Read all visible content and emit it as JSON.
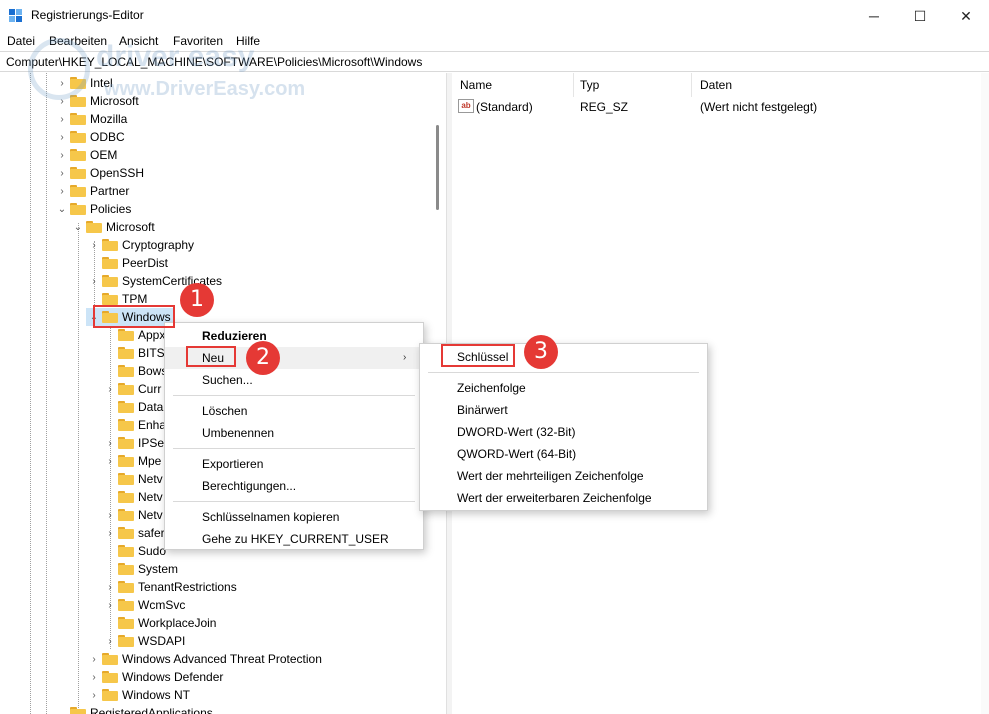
{
  "window": {
    "title": "Registrierungs-Editor",
    "minimize_glyph": "─",
    "maximize_glyph": "☐",
    "close_glyph": "✕"
  },
  "menu": [
    "Datei",
    "Bearbeiten",
    "Ansicht",
    "Favoriten",
    "Hilfe"
  ],
  "address": "Computer\\HKEY_LOCAL_MACHINE\\SOFTWARE\\Policies\\Microsoft\\Windows",
  "watermark": {
    "line1": "driver easy",
    "line2": "www.DriverEasy.com"
  },
  "tree": {
    "top_items": [
      "Intel",
      "Microsoft",
      "Mozilla",
      "ODBC",
      "OEM",
      "OpenSSH",
      "Partner"
    ],
    "policies": "Policies",
    "policies_microsoft": "Microsoft",
    "ms_children": [
      "Cryptography",
      "PeerDist",
      "SystemCertificates",
      "TPM"
    ],
    "windows_key": "Windows",
    "windows_children": [
      "Appx",
      "BITS",
      "Bows",
      "Curr",
      "Data",
      "Enha",
      "IPSec",
      "Mpe",
      "Netv",
      "Netv",
      "Netv",
      "safer",
      "Sudo",
      "System",
      "TenantRestrictions",
      "WcmSvc",
      "WorkplaceJoin",
      "WSDAPI"
    ],
    "after_windows": [
      "Windows Advanced Threat Protection",
      "Windows Defender",
      "Windows NT"
    ],
    "bottom_partial": "RegisteredApplications"
  },
  "list": {
    "columns": [
      "Name",
      "Typ",
      "Daten"
    ],
    "rows": [
      {
        "icon": "ab",
        "name": "(Standard)",
        "type": "REG_SZ",
        "data": "(Wert nicht festgelegt)"
      }
    ]
  },
  "context_menu": {
    "collapse": "Reduzieren",
    "new": "Neu",
    "find": "Suchen...",
    "delete": "Löschen",
    "rename": "Umbenennen",
    "export": "Exportieren",
    "permissions": "Berechtigungen...",
    "copy_key_name": "Schlüsselnamen kopieren",
    "goto_hkcu": "Gehe zu HKEY_CURRENT_USER"
  },
  "submenu": {
    "key": "Schlüssel",
    "string": "Zeichenfolge",
    "binary": "Binärwert",
    "dword": "DWORD-Wert (32-Bit)",
    "qword": "QWORD-Wert (64-Bit)",
    "multi_string": "Wert der mehrteiligen Zeichenfolge",
    "expand_string": "Wert der erweiterbaren Zeichenfolge"
  },
  "callouts": [
    "1",
    "2",
    "3"
  ],
  "colors": {
    "callout": "#e53935",
    "folder": "#f6c74a",
    "registry_icon": "#1a6fd1"
  }
}
